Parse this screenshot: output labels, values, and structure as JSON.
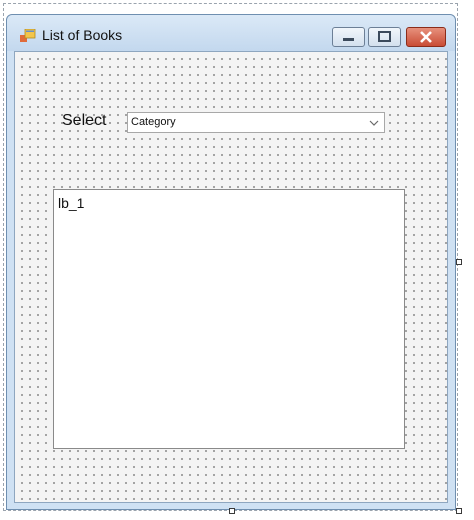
{
  "window": {
    "title": "List of Books"
  },
  "form": {
    "select_label": "Select",
    "combo_value": "Category",
    "listbox_text": "lb_1"
  },
  "icons": {
    "app": "form-app-icon",
    "minimize": "minimize-icon",
    "maximize": "maximize-icon",
    "close": "close-icon",
    "dropdown": "chevron-down-icon"
  },
  "colors": {
    "close_button": "#c94c35",
    "titlebar": "#cfe1f3",
    "canvas_grid": "#5c5c5c"
  }
}
